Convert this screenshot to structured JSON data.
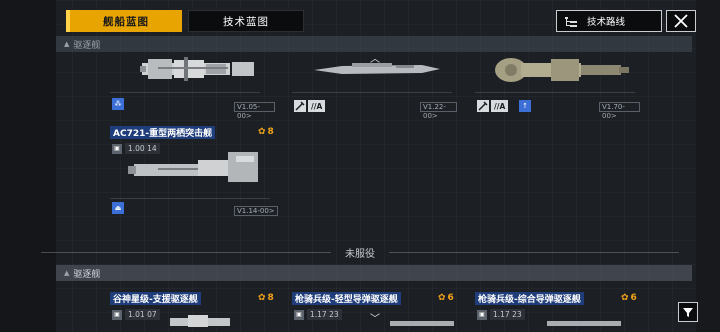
{
  "tabs": [
    {
      "label": "舰船蓝图",
      "active": true
    },
    {
      "label": "技术蓝图",
      "active": false
    }
  ],
  "header": {
    "tech_route_label": "技术路线"
  },
  "sections": {
    "top": "驱逐舰",
    "bottom": "驱逐舰",
    "divider": "未服役"
  },
  "row1": [
    {
      "version": "V1.05-00>",
      "icon": "unit-icon",
      "tags": []
    },
    {
      "version": "V1.22-00>",
      "icon": "",
      "tags": [
        "//A"
      ]
    },
    {
      "version": "V1.70-00>",
      "icon": "arrow-up-icon",
      "tags": [
        "//A"
      ]
    }
  ],
  "row2": {
    "name": "AC721-重型两栖突击舰",
    "cost": "8",
    "level": "1.00 14",
    "version": "V1.14-00>"
  },
  "row3": [
    {
      "name": "谷神星级-支援驱逐舰",
      "cost": "8",
      "level": "1.01 07"
    },
    {
      "name": "枪骑兵级-轻型导弹驱逐舰",
      "cost": "6",
      "level": "1.17 23"
    },
    {
      "name": "枪骑兵级-综合导弹驱逐舰",
      "cost": "6",
      "level": "1.17 23"
    }
  ],
  "colors": {
    "accent": "#e8a400",
    "name_bg": "#1f3d7a",
    "cost": "#f2a31a",
    "icon_blue": "#3b6fd6"
  }
}
